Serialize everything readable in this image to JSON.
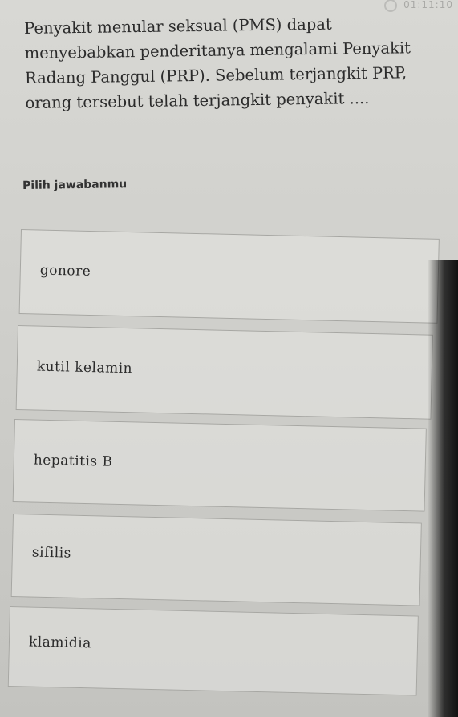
{
  "timer": {
    "icon": "clock-icon",
    "text": "01:11:10"
  },
  "question": {
    "text": "Penyakit menular seksual (PMS) dapat menyebabkan penderitanya mengalami Penyakit Radang Panggul (PRP). Sebelum terjangkit PRP, orang tersebut telah terjangkit penyakit ...."
  },
  "prompt": {
    "text": "Pilih jawabanmu"
  },
  "options": [
    {
      "label": "gonore"
    },
    {
      "label": "kutil kelamin"
    },
    {
      "label": "hepatitis B"
    },
    {
      "label": "sifilis"
    },
    {
      "label": "klamidia"
    }
  ],
  "colors": {
    "background": "#cfcfcb",
    "option_border": "#a7a7a3",
    "text": "#2a2a2a"
  }
}
